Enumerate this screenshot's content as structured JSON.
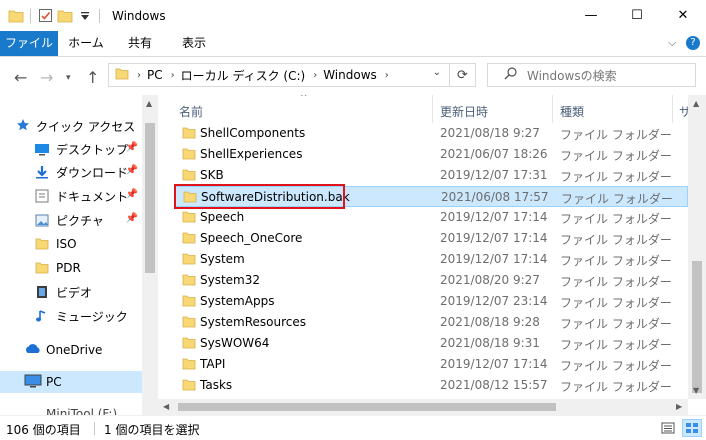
{
  "window": {
    "title": "Windows",
    "min_glyph": "—",
    "max_glyph": "☐",
    "close_glyph": "✕"
  },
  "ribbon": {
    "tabs": [
      "ファイル",
      "ホーム",
      "共有",
      "表示"
    ],
    "chevron": "⌵",
    "help": "?"
  },
  "address": {
    "crumbs": [
      "PC",
      "ローカル ディスク (C:)",
      "Windows"
    ],
    "search_placeholder": "Windowsの検索"
  },
  "nav": {
    "quick_access": "クイック アクセス",
    "items": [
      {
        "label": "デスクトップ",
        "icon": "desktop-icon",
        "pinned": true
      },
      {
        "label": "ダウンロード",
        "icon": "download-icon",
        "pinned": true
      },
      {
        "label": "ドキュメント",
        "icon": "document-icon",
        "pinned": true
      },
      {
        "label": "ピクチャ",
        "icon": "picture-icon",
        "pinned": true
      },
      {
        "label": "ISO",
        "icon": "folder-icon",
        "pinned": false
      },
      {
        "label": "PDR",
        "icon": "folder-icon",
        "pinned": false
      },
      {
        "label": "ビデオ",
        "icon": "video-icon",
        "pinned": false
      },
      {
        "label": "ミュージック",
        "icon": "music-icon",
        "pinned": false
      }
    ],
    "onedrive": "OneDrive",
    "pc": "PC",
    "minitool": "MiniTool (F:)"
  },
  "columns": {
    "name": "名前",
    "date": "更新日時",
    "type": "種類",
    "size": "サ"
  },
  "files": [
    {
      "name": "ShellComponents",
      "date": "2021/08/18 9:27",
      "type": "ファイル フォルダー"
    },
    {
      "name": "ShellExperiences",
      "date": "2021/06/07 18:26",
      "type": "ファイル フォルダー"
    },
    {
      "name": "SKB",
      "date": "2019/12/07 17:31",
      "type": "ファイル フォルダー"
    },
    {
      "name": "SoftwareDistribution.bak",
      "date": "2021/06/08 17:57",
      "type": "ファイル フォルダー",
      "selected": true
    },
    {
      "name": "Speech",
      "date": "2019/12/07 17:14",
      "type": "ファイル フォルダー"
    },
    {
      "name": "Speech_OneCore",
      "date": "2019/12/07 17:14",
      "type": "ファイル フォルダー"
    },
    {
      "name": "System",
      "date": "2019/12/07 17:14",
      "type": "ファイル フォルダー"
    },
    {
      "name": "System32",
      "date": "2021/08/20 9:27",
      "type": "ファイル フォルダー"
    },
    {
      "name": "SystemApps",
      "date": "2019/12/07 23:14",
      "type": "ファイル フォルダー"
    },
    {
      "name": "SystemResources",
      "date": "2021/08/18 9:28",
      "type": "ファイル フォルダー"
    },
    {
      "name": "SysWOW64",
      "date": "2021/08/18 9:31",
      "type": "ファイル フォルダー"
    },
    {
      "name": "TAPI",
      "date": "2019/12/07 17:14",
      "type": "ファイル フォルダー"
    },
    {
      "name": "Tasks",
      "date": "2021/08/12 15:57",
      "type": "ファイル フォルダー"
    }
  ],
  "status": {
    "count": "106 個の項目",
    "selection": "1 個の項目を選択"
  },
  "colors": {
    "file_tab": "#1979ca",
    "selection": "#cce8ff",
    "highlight_box": "#e0131a",
    "folder": "#f8d775"
  }
}
